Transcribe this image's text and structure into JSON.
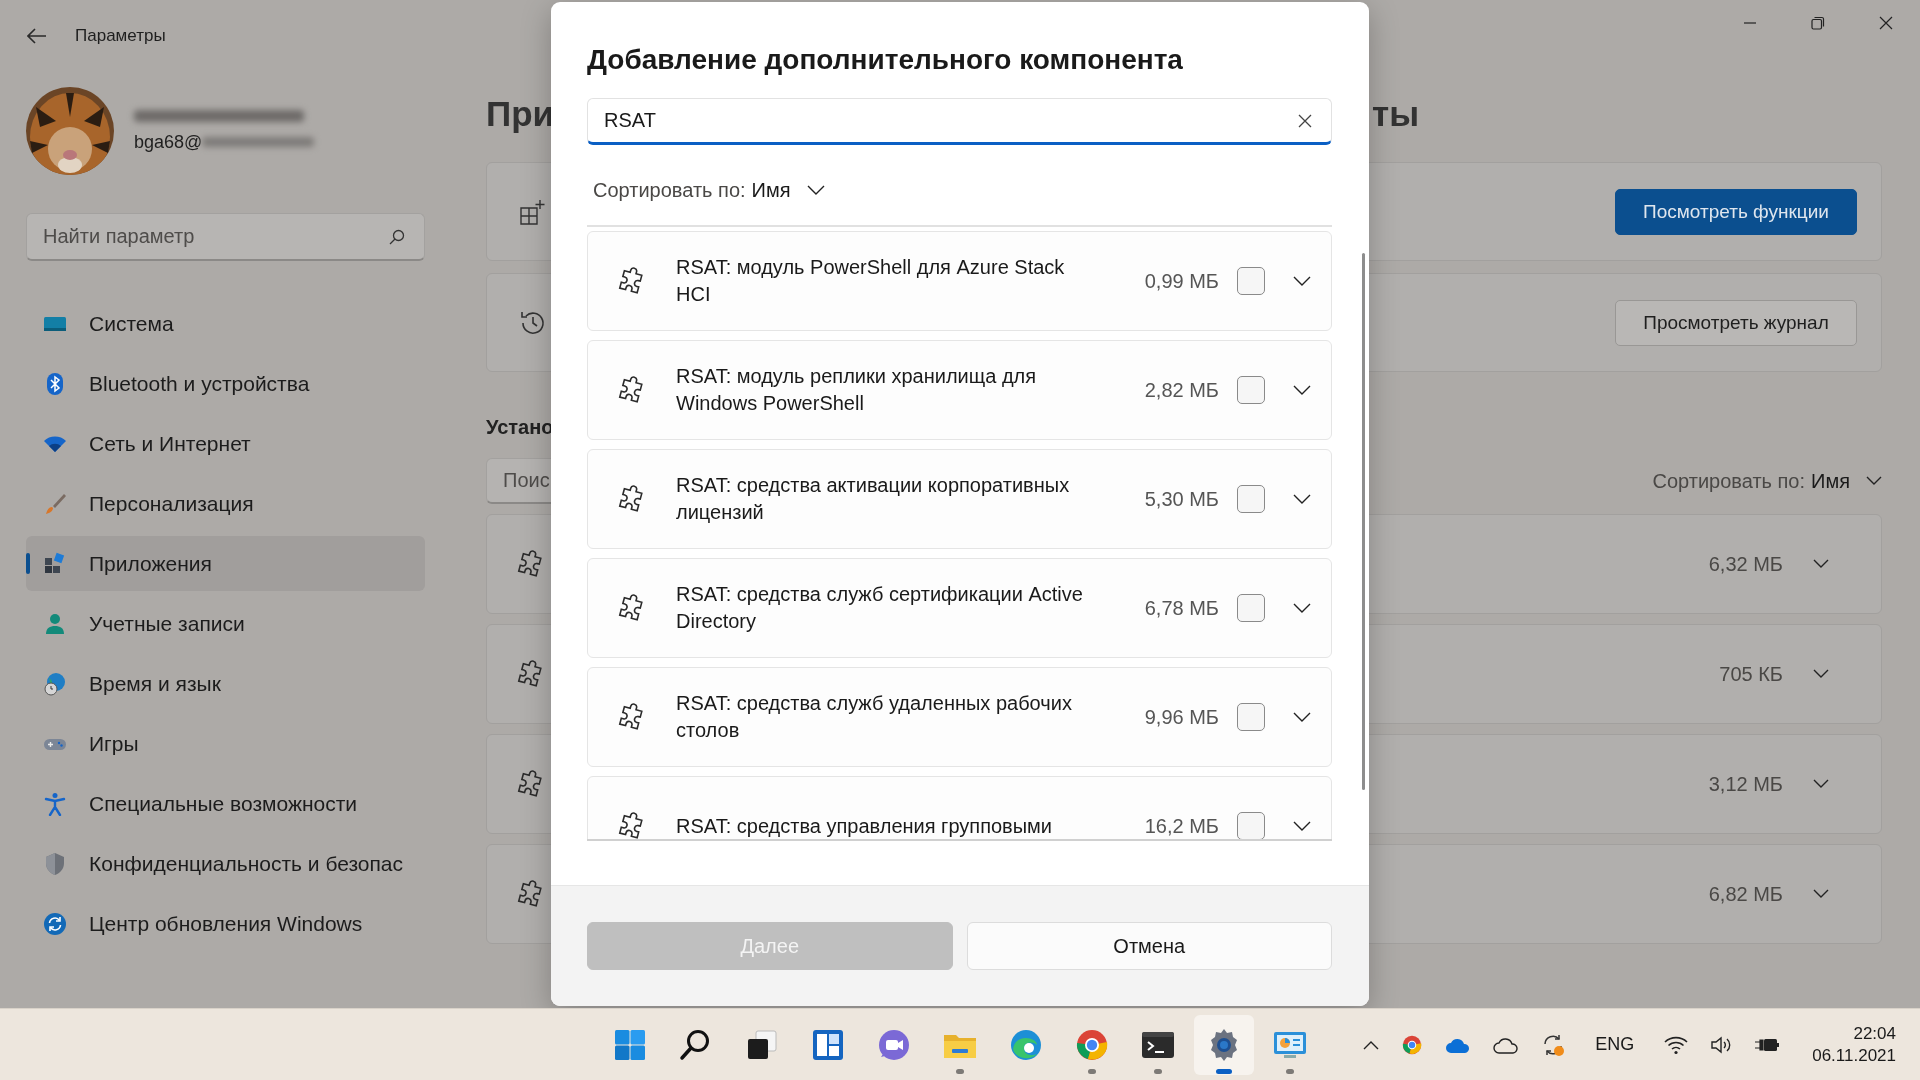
{
  "window": {
    "title": "Параметры"
  },
  "account": {
    "email": "bga68@"
  },
  "search": {
    "placeholder": "Найти параметр"
  },
  "nav": [
    {
      "label": "Система",
      "kind": "system",
      "selected": false
    },
    {
      "label": "Bluetooth и устройства",
      "kind": "bluetooth",
      "selected": false
    },
    {
      "label": "Сеть и Интернет",
      "kind": "network",
      "selected": false
    },
    {
      "label": "Персонализация",
      "kind": "brush",
      "selected": false
    },
    {
      "label": "Приложения",
      "kind": "apps",
      "selected": true
    },
    {
      "label": "Учетные записи",
      "kind": "person",
      "selected": false
    },
    {
      "label": "Время и язык",
      "kind": "time",
      "selected": false
    },
    {
      "label": "Игры",
      "kind": "gamepad",
      "selected": false
    },
    {
      "label": "Специальные возможности",
      "kind": "accessibility",
      "selected": false
    },
    {
      "label": "Конфиденциальность и безопас",
      "kind": "shield",
      "selected": false
    },
    {
      "label": "Центр обновления Windows",
      "kind": "update",
      "selected": false
    }
  ],
  "page": {
    "title_left": "При",
    "title_right": "ты",
    "actions": [
      {
        "kind": "add",
        "label": "Посмотреть функции",
        "primary": true
      },
      {
        "kind": "history",
        "label": "Просмотреть журнал",
        "primary": false
      }
    ],
    "installed_heading": "Устано",
    "search_placeholder": "Поис",
    "sort_label": "Сортировать по:",
    "sort_value": "Имя",
    "installed": [
      {
        "size": "6,32 МБ"
      },
      {
        "size": "705 КБ"
      },
      {
        "size": "3,12 МБ"
      },
      {
        "size": "6,82 МБ"
      }
    ]
  },
  "dialog": {
    "title": "Добавление дополнительного компонента",
    "search_value": "RSAT",
    "sort_label": "Сортировать по:",
    "sort_value": "Имя",
    "items": [
      {
        "name": "RSAT: модуль PowerShell для Azure Stack HCI",
        "size": "0,99 МБ",
        "checked": false
      },
      {
        "name": "RSAT: модуль реплики хранилища для Windows PowerShell",
        "size": "2,82 МБ",
        "checked": false
      },
      {
        "name": "RSAT: средства активации корпоративных лицензий",
        "size": "5,30 МБ",
        "checked": false
      },
      {
        "name": "RSAT: средства служб сертификации Active Directory",
        "size": "6,78 МБ",
        "checked": false
      },
      {
        "name": "RSAT: средства служб удаленных рабочих столов",
        "size": "9,96 МБ",
        "checked": false
      },
      {
        "name": "RSAT: средства управления групповыми",
        "size": "16,2 МБ",
        "checked": false
      }
    ],
    "buttons": [
      {
        "label": "Далее",
        "disabled": true
      },
      {
        "label": "Отмена",
        "disabled": false
      }
    ]
  },
  "taskbar": {
    "apps": [
      {
        "kind": "start",
        "running": false,
        "selected": false
      },
      {
        "kind": "search",
        "running": false,
        "selected": false
      },
      {
        "kind": "taskview",
        "running": false,
        "selected": false
      },
      {
        "kind": "widgets",
        "running": false,
        "selected": false
      },
      {
        "kind": "chat",
        "running": false,
        "selected": false
      },
      {
        "kind": "explorer",
        "running": true,
        "selected": false
      },
      {
        "kind": "edge",
        "running": false,
        "selected": false
      },
      {
        "kind": "chrome",
        "running": true,
        "selected": false
      },
      {
        "kind": "terminal",
        "running": true,
        "selected": false
      },
      {
        "kind": "settings",
        "running": true,
        "selected": true
      },
      {
        "kind": "monitor",
        "running": true,
        "selected": false
      }
    ],
    "language": "ENG",
    "time": "22:04",
    "date": "06.11.2021"
  }
}
